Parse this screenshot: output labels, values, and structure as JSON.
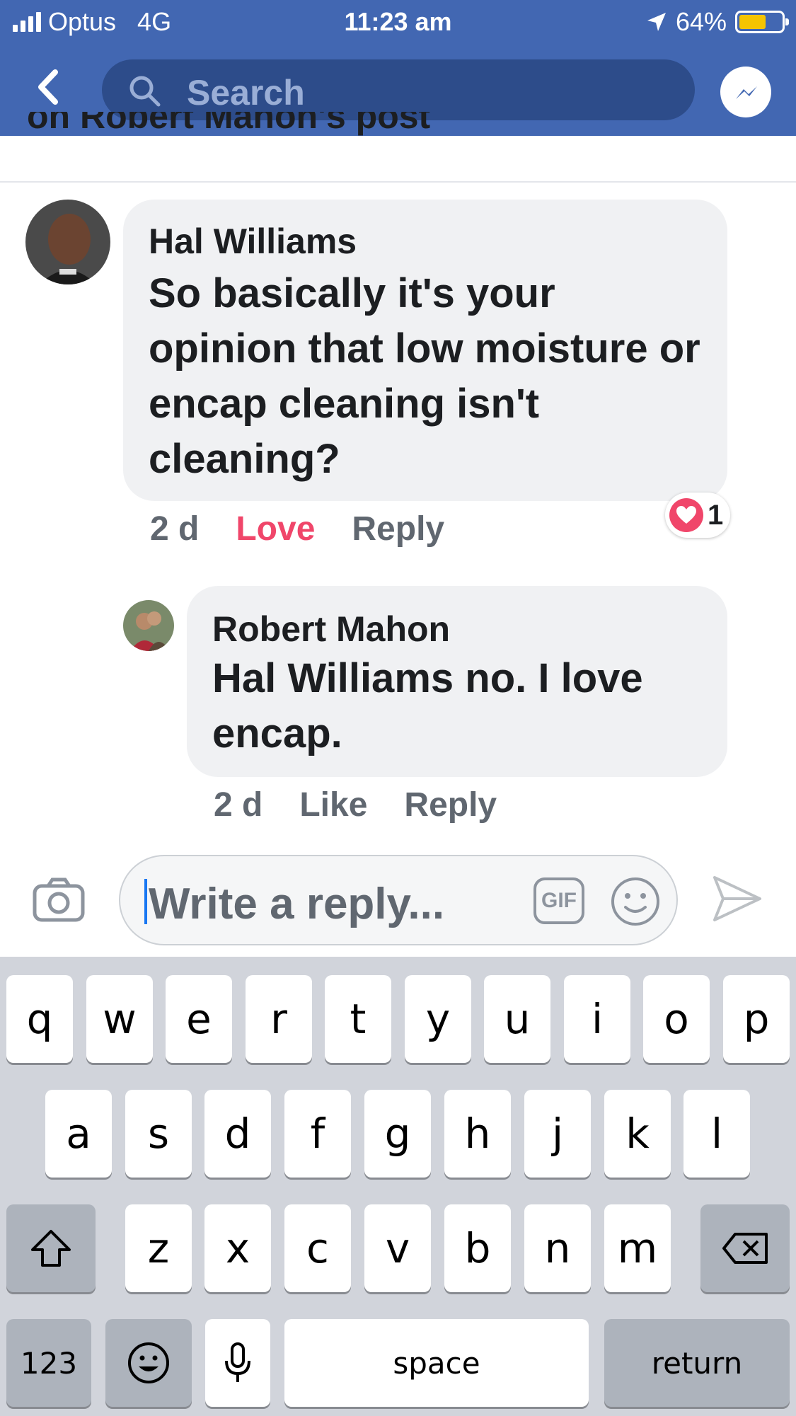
{
  "status_bar": {
    "carrier": "Optus",
    "network": "4G",
    "time": "11:23 am",
    "battery": "64%",
    "battery_level": 0.64
  },
  "nav": {
    "search_placeholder": "Search"
  },
  "header": {
    "cropped_title": "on Robert Mahon's post"
  },
  "comments": [
    {
      "author": "Hal Williams",
      "text": "So basically it's your opinion that low moisture or encap cleaning isn't cleaning?",
      "time": "2 d",
      "reaction_action": "Love",
      "reply": "Reply",
      "reaction_count": "1",
      "reaction_type": "heart"
    },
    {
      "author": "Robert Mahon",
      "mention": "Hal Williams",
      "text": " no. I love encap.",
      "time": "2 d",
      "like": "Like",
      "reply": "Reply"
    }
  ],
  "composer": {
    "placeholder": "Write a reply...",
    "gif_label": "GIF"
  },
  "keyboard": {
    "row1": [
      "q",
      "w",
      "e",
      "r",
      "t",
      "y",
      "u",
      "i",
      "o",
      "p"
    ],
    "row2": [
      "a",
      "s",
      "d",
      "f",
      "g",
      "h",
      "j",
      "k",
      "l"
    ],
    "row3": [
      "z",
      "x",
      "c",
      "v",
      "b",
      "n",
      "m"
    ],
    "numbers": "123",
    "space": "space",
    "return": "return"
  },
  "colors": {
    "facebook_blue": "#4267b2",
    "love_red": "#f0466a",
    "bubble_gray": "#f0f1f3"
  }
}
